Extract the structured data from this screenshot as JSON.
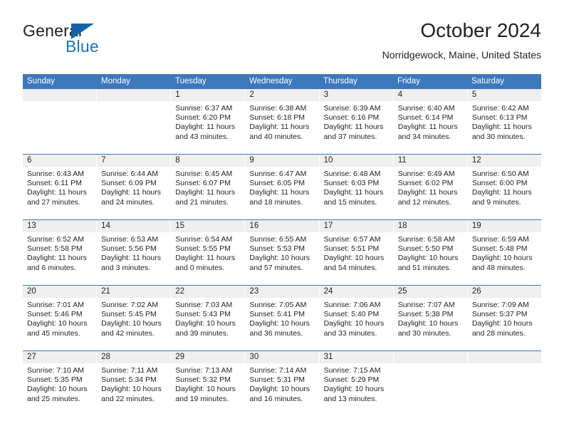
{
  "brand": {
    "name_top": "General",
    "name_bottom": "Blue",
    "triangle_icon": "blue-triangle-icon",
    "accent_color": "#1b75bb"
  },
  "header": {
    "title": "October 2024",
    "subtitle": "Norridgewock, Maine, United States"
  },
  "calendar": {
    "header_bg": "#3c78bc",
    "day_band_bg": "#efefef",
    "weekdays": [
      "Sunday",
      "Monday",
      "Tuesday",
      "Wednesday",
      "Thursday",
      "Friday",
      "Saturday"
    ],
    "weeks": [
      [
        {
          "day": "",
          "empty": true
        },
        {
          "day": "",
          "empty": true
        },
        {
          "day": "1",
          "sunrise": "Sunrise: 6:37 AM",
          "sunset": "Sunset: 6:20 PM",
          "daylight": "Daylight: 11 hours and 43 minutes."
        },
        {
          "day": "2",
          "sunrise": "Sunrise: 6:38 AM",
          "sunset": "Sunset: 6:18 PM",
          "daylight": "Daylight: 11 hours and 40 minutes."
        },
        {
          "day": "3",
          "sunrise": "Sunrise: 6:39 AM",
          "sunset": "Sunset: 6:16 PM",
          "daylight": "Daylight: 11 hours and 37 minutes."
        },
        {
          "day": "4",
          "sunrise": "Sunrise: 6:40 AM",
          "sunset": "Sunset: 6:14 PM",
          "daylight": "Daylight: 11 hours and 34 minutes."
        },
        {
          "day": "5",
          "sunrise": "Sunrise: 6:42 AM",
          "sunset": "Sunset: 6:13 PM",
          "daylight": "Daylight: 11 hours and 30 minutes."
        }
      ],
      [
        {
          "day": "6",
          "sunrise": "Sunrise: 6:43 AM",
          "sunset": "Sunset: 6:11 PM",
          "daylight": "Daylight: 11 hours and 27 minutes."
        },
        {
          "day": "7",
          "sunrise": "Sunrise: 6:44 AM",
          "sunset": "Sunset: 6:09 PM",
          "daylight": "Daylight: 11 hours and 24 minutes."
        },
        {
          "day": "8",
          "sunrise": "Sunrise: 6:45 AM",
          "sunset": "Sunset: 6:07 PM",
          "daylight": "Daylight: 11 hours and 21 minutes."
        },
        {
          "day": "9",
          "sunrise": "Sunrise: 6:47 AM",
          "sunset": "Sunset: 6:05 PM",
          "daylight": "Daylight: 11 hours and 18 minutes."
        },
        {
          "day": "10",
          "sunrise": "Sunrise: 6:48 AM",
          "sunset": "Sunset: 6:03 PM",
          "daylight": "Daylight: 11 hours and 15 minutes."
        },
        {
          "day": "11",
          "sunrise": "Sunrise: 6:49 AM",
          "sunset": "Sunset: 6:02 PM",
          "daylight": "Daylight: 11 hours and 12 minutes."
        },
        {
          "day": "12",
          "sunrise": "Sunrise: 6:50 AM",
          "sunset": "Sunset: 6:00 PM",
          "daylight": "Daylight: 11 hours and 9 minutes."
        }
      ],
      [
        {
          "day": "13",
          "sunrise": "Sunrise: 6:52 AM",
          "sunset": "Sunset: 5:58 PM",
          "daylight": "Daylight: 11 hours and 6 minutes."
        },
        {
          "day": "14",
          "sunrise": "Sunrise: 6:53 AM",
          "sunset": "Sunset: 5:56 PM",
          "daylight": "Daylight: 11 hours and 3 minutes."
        },
        {
          "day": "15",
          "sunrise": "Sunrise: 6:54 AM",
          "sunset": "Sunset: 5:55 PM",
          "daylight": "Daylight: 11 hours and 0 minutes."
        },
        {
          "day": "16",
          "sunrise": "Sunrise: 6:55 AM",
          "sunset": "Sunset: 5:53 PM",
          "daylight": "Daylight: 10 hours and 57 minutes."
        },
        {
          "day": "17",
          "sunrise": "Sunrise: 6:57 AM",
          "sunset": "Sunset: 5:51 PM",
          "daylight": "Daylight: 10 hours and 54 minutes."
        },
        {
          "day": "18",
          "sunrise": "Sunrise: 6:58 AM",
          "sunset": "Sunset: 5:50 PM",
          "daylight": "Daylight: 10 hours and 51 minutes."
        },
        {
          "day": "19",
          "sunrise": "Sunrise: 6:59 AM",
          "sunset": "Sunset: 5:48 PM",
          "daylight": "Daylight: 10 hours and 48 minutes."
        }
      ],
      [
        {
          "day": "20",
          "sunrise": "Sunrise: 7:01 AM",
          "sunset": "Sunset: 5:46 PM",
          "daylight": "Daylight: 10 hours and 45 minutes."
        },
        {
          "day": "21",
          "sunrise": "Sunrise: 7:02 AM",
          "sunset": "Sunset: 5:45 PM",
          "daylight": "Daylight: 10 hours and 42 minutes."
        },
        {
          "day": "22",
          "sunrise": "Sunrise: 7:03 AM",
          "sunset": "Sunset: 5:43 PM",
          "daylight": "Daylight: 10 hours and 39 minutes."
        },
        {
          "day": "23",
          "sunrise": "Sunrise: 7:05 AM",
          "sunset": "Sunset: 5:41 PM",
          "daylight": "Daylight: 10 hours and 36 minutes."
        },
        {
          "day": "24",
          "sunrise": "Sunrise: 7:06 AM",
          "sunset": "Sunset: 5:40 PM",
          "daylight": "Daylight: 10 hours and 33 minutes."
        },
        {
          "day": "25",
          "sunrise": "Sunrise: 7:07 AM",
          "sunset": "Sunset: 5:38 PM",
          "daylight": "Daylight: 10 hours and 30 minutes."
        },
        {
          "day": "26",
          "sunrise": "Sunrise: 7:09 AM",
          "sunset": "Sunset: 5:37 PM",
          "daylight": "Daylight: 10 hours and 28 minutes."
        }
      ],
      [
        {
          "day": "27",
          "sunrise": "Sunrise: 7:10 AM",
          "sunset": "Sunset: 5:35 PM",
          "daylight": "Daylight: 10 hours and 25 minutes."
        },
        {
          "day": "28",
          "sunrise": "Sunrise: 7:11 AM",
          "sunset": "Sunset: 5:34 PM",
          "daylight": "Daylight: 10 hours and 22 minutes."
        },
        {
          "day": "29",
          "sunrise": "Sunrise: 7:13 AM",
          "sunset": "Sunset: 5:32 PM",
          "daylight": "Daylight: 10 hours and 19 minutes."
        },
        {
          "day": "30",
          "sunrise": "Sunrise: 7:14 AM",
          "sunset": "Sunset: 5:31 PM",
          "daylight": "Daylight: 10 hours and 16 minutes."
        },
        {
          "day": "31",
          "sunrise": "Sunrise: 7:15 AM",
          "sunset": "Sunset: 5:29 PM",
          "daylight": "Daylight: 10 hours and 13 minutes."
        },
        {
          "day": "",
          "empty": true
        },
        {
          "day": "",
          "empty": true
        }
      ]
    ]
  }
}
